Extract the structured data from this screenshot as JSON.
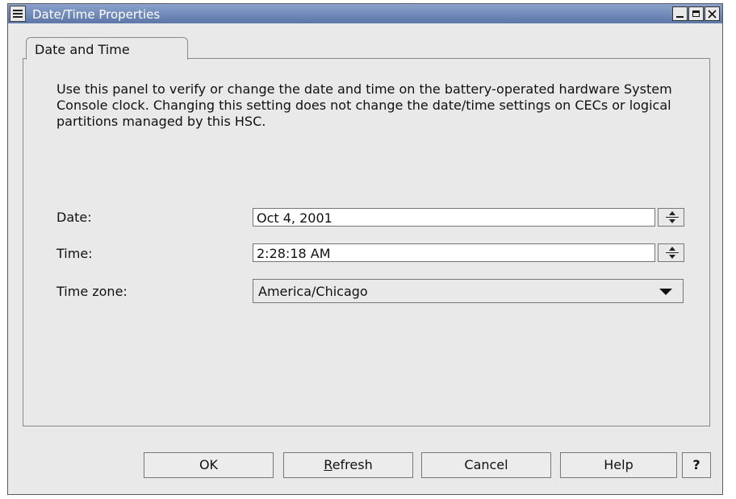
{
  "window": {
    "title": "Date/Time Properties",
    "controls": [
      "minimize-icon",
      "maximize-icon",
      "close-icon"
    ]
  },
  "tab": {
    "label": "Date and Time"
  },
  "description": "Use this panel to verify or change the date and time on the battery-operated hardware System Console clock.  Changing this setting does not change the date/time settings on CECs or logical partitions managed by this HSC.",
  "fields": {
    "date": {
      "label": "Date:",
      "value": "Oct 4, 2001"
    },
    "time": {
      "label": "Time:",
      "value": "2:28:18 AM"
    },
    "timezone": {
      "label": "Time zone:",
      "value": "America/Chicago"
    }
  },
  "buttons": {
    "ok": "OK",
    "refresh_mnemonic": "R",
    "refresh_rest": "efresh",
    "cancel": "Cancel",
    "help": "Help",
    "context_help": "?"
  }
}
